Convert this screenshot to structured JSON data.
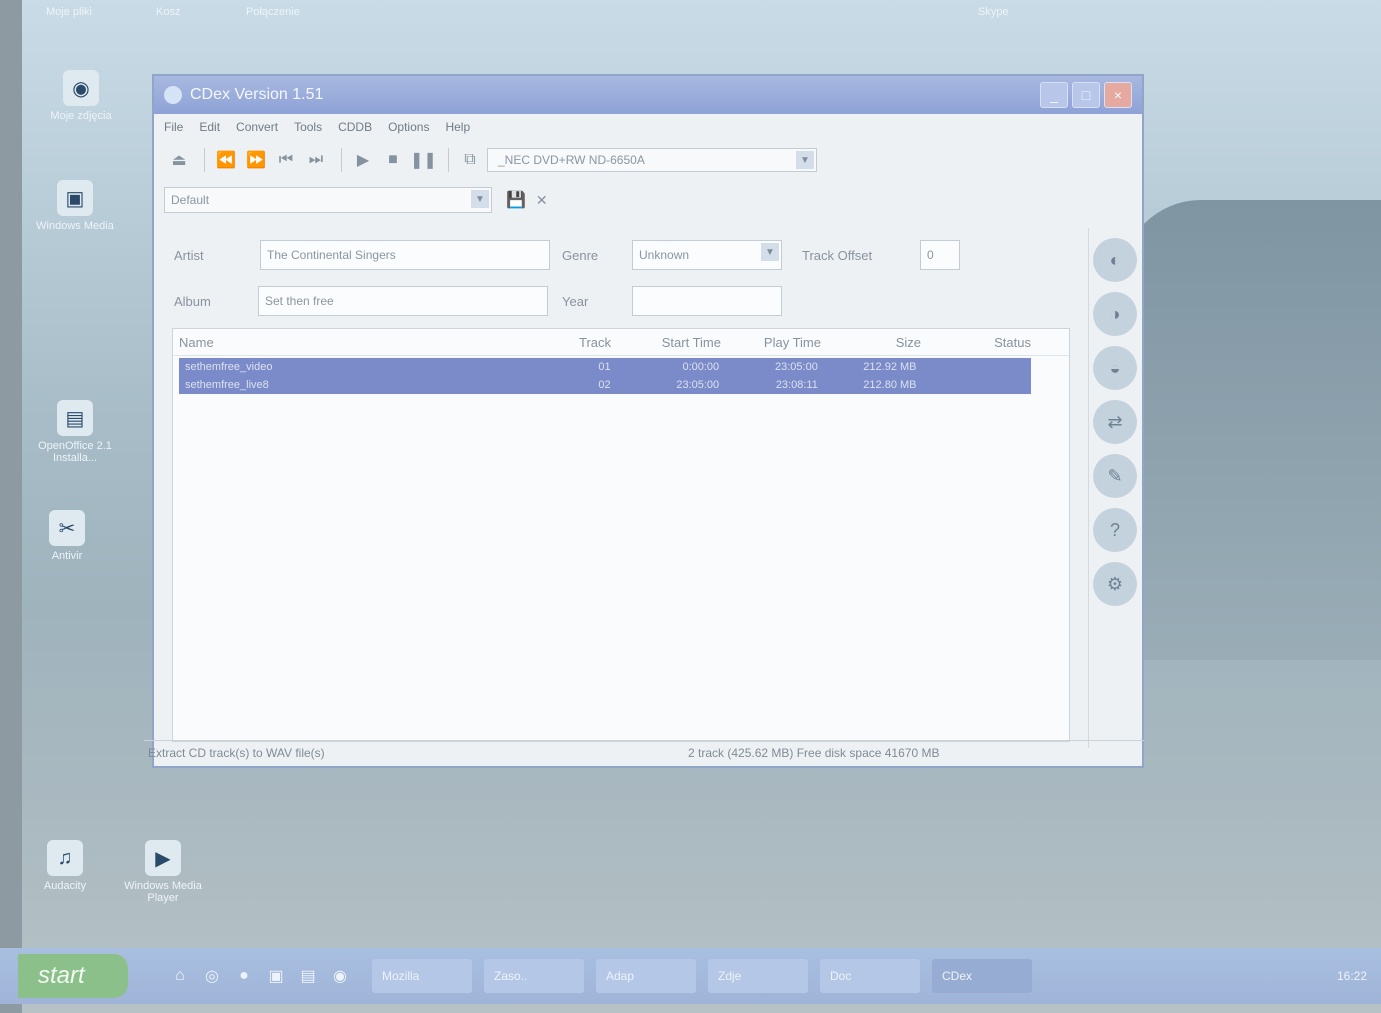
{
  "window": {
    "title": "CDex Version 1.51",
    "minimize": "_",
    "maximize": "□",
    "close": "×"
  },
  "menu": [
    "File",
    "Edit",
    "Convert",
    "Tools",
    "CDDB",
    "Options",
    "Help"
  ],
  "toolbar": {
    "drive": "_NEC   DVD+RW ND-6650A",
    "profile": "Default"
  },
  "fields": {
    "artist_label": "Artist",
    "artist_value": "The Continental Singers",
    "album_label": "Album",
    "album_value": "Set then free",
    "genre_label": "Genre",
    "genre_value": "Unknown",
    "year_label": "Year",
    "year_value": "",
    "track_offset_label": "Track Offset",
    "track_offset_value": "0"
  },
  "table": {
    "headers": [
      "Name",
      "Track",
      "Start Time",
      "Play Time",
      "Size",
      "Status"
    ],
    "rows": [
      {
        "name": "sethemfree_video",
        "track": "01",
        "start": "0:00:00",
        "play": "23:05:00",
        "size": "212.92 MB",
        "status": ""
      },
      {
        "name": "sethemfree_live8",
        "track": "02",
        "start": "23:05:00",
        "play": "23:08:11",
        "size": "212.80 MB",
        "status": ""
      }
    ]
  },
  "status": {
    "left": "Extract CD track(s) to WAV file(s)",
    "right": "2 track (425.62 MB) Free disk space 41670 MB"
  },
  "desktop_icons": [
    {
      "label": "Moje zdjęcia",
      "icon": "globe-icon"
    },
    {
      "label": "Windows Media",
      "icon": "media-icon"
    },
    {
      "label": "OpenOffice 2.1 Installa...",
      "icon": "folder-icon"
    },
    {
      "label": "Audacity",
      "icon": "audio-icon"
    },
    {
      "label": "Antivir",
      "icon": "scissors-icon"
    },
    {
      "label": "Windows Media Player",
      "icon": "player-icon"
    }
  ],
  "top_labels": [
    "Moje pliki",
    "Kosz",
    "Połączenie",
    "Skype"
  ],
  "taskbar": {
    "start": "start",
    "tasks": [
      "Mozilla",
      "Zaso..",
      "Adap",
      "Zdje",
      "Doc",
      "CDex"
    ],
    "tray": "16:22"
  }
}
